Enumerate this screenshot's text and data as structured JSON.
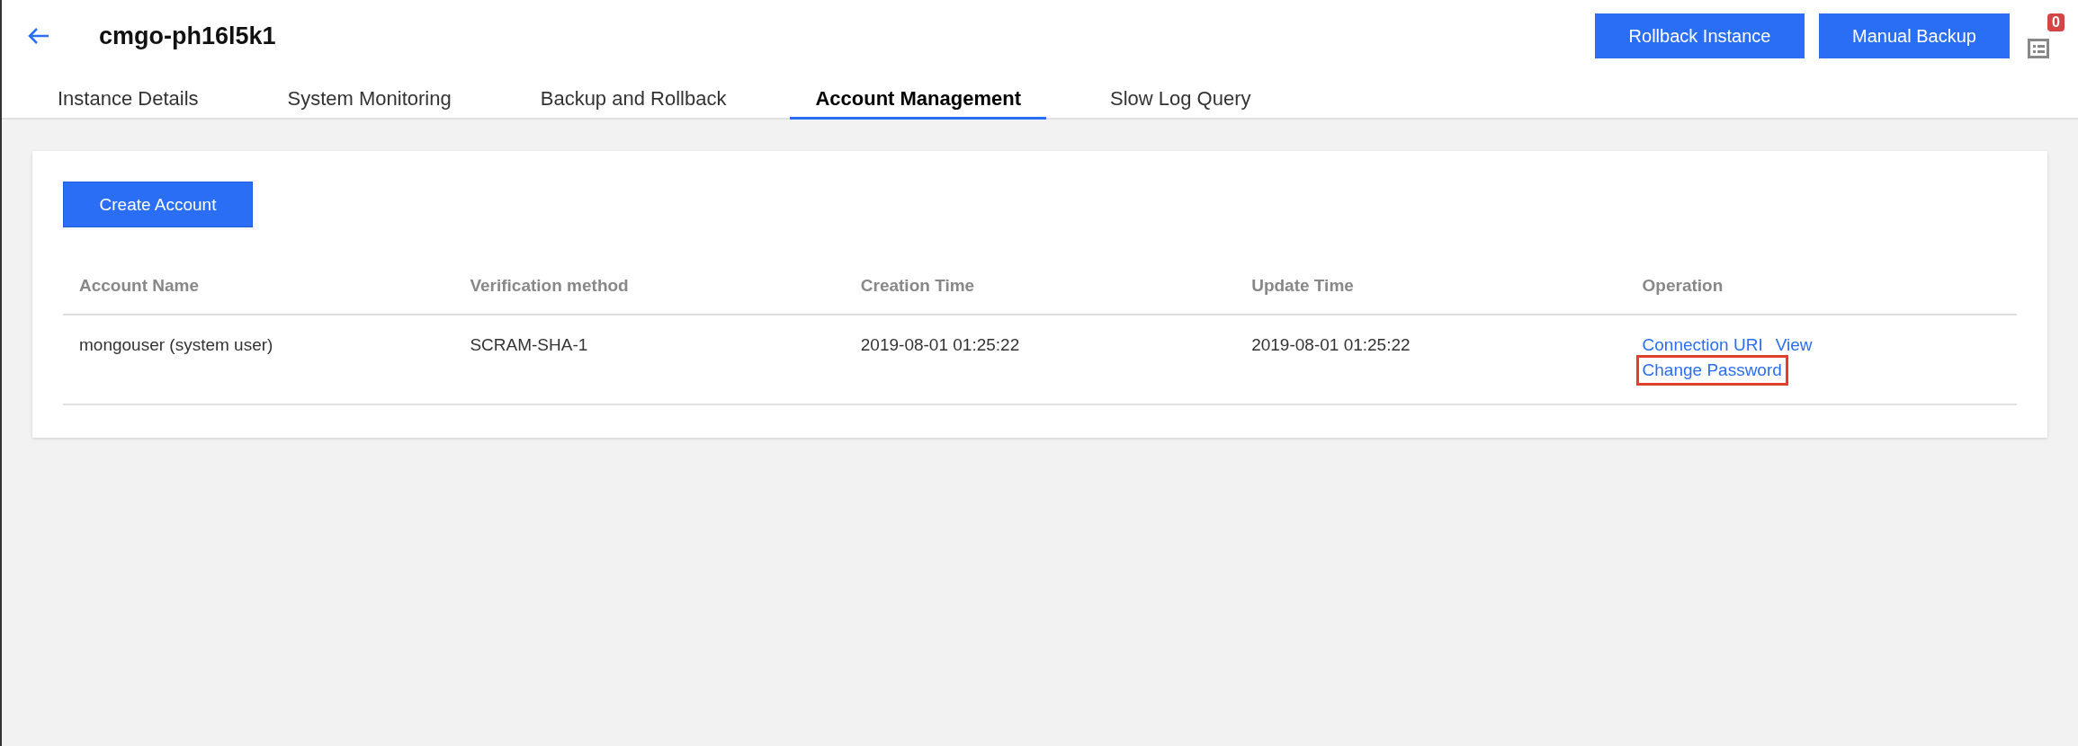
{
  "header": {
    "title": "cmgo-ph16l5k1",
    "buttons": [
      "Rollback Instance",
      "Manual Backup"
    ],
    "task_badge": "0"
  },
  "tabs": [
    {
      "label": "Instance Details",
      "selected": false
    },
    {
      "label": "System Monitoring",
      "selected": false
    },
    {
      "label": "Backup and Rollback",
      "selected": false
    },
    {
      "label": "Account Management",
      "selected": true
    },
    {
      "label": "Slow Log Query",
      "selected": false
    }
  ],
  "create_button": "Create Account",
  "table": {
    "columns": [
      "Account Name",
      "Verification method",
      "Creation Time",
      "Update Time",
      "Operation"
    ],
    "rows": [
      {
        "cells": [
          "mongouser (system user)",
          "SCRAM-SHA-1",
          "2019-08-01 01:25:22",
          "2019-08-01 01:25:22"
        ],
        "operations": [
          [
            {
              "label": "Connection URI",
              "highlighted": false
            },
            {
              "label": "View",
              "highlighted": false
            }
          ],
          [
            {
              "label": "Change Password",
              "highlighted": true
            }
          ]
        ]
      }
    ]
  }
}
